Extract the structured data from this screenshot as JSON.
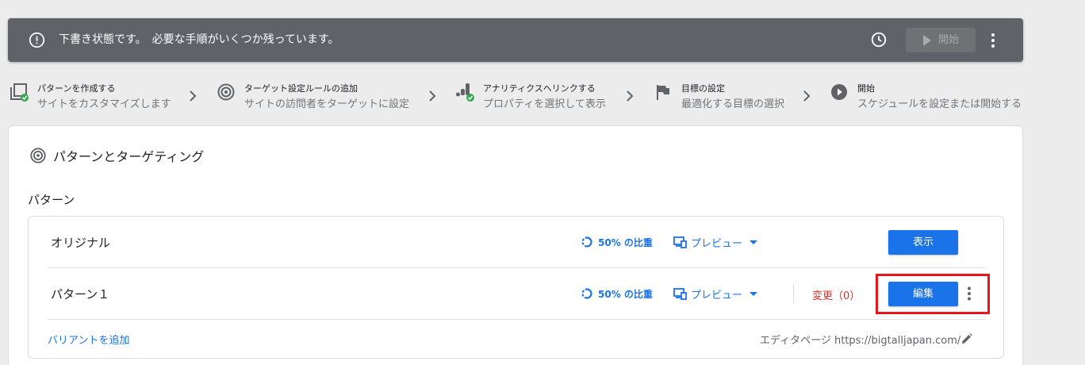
{
  "status_bar": {
    "message": "下書き状態です。　必要な手順がいくつか残っています。",
    "start_label": "開始",
    "icons": [
      "alert-circle-icon",
      "clock-icon",
      "play-icon",
      "more-vert-icon"
    ]
  },
  "steps": [
    {
      "title": "パターンを作成する",
      "subtitle": "サイトをカスタマイズします",
      "icon": "variants-check-icon"
    },
    {
      "title": "ターゲット設定ルールの追加",
      "subtitle": "サイトの訪問者をターゲットに設定",
      "icon": "target-icon"
    },
    {
      "title": "アナリティクスへリンクする",
      "subtitle": "プロパティを選択して表示",
      "icon": "analytics-check-icon"
    },
    {
      "title": "目標の設定",
      "subtitle": "最適化する目標の選択",
      "icon": "flag-icon"
    },
    {
      "title": "開始",
      "subtitle": "スケジュールを設定または開始する",
      "icon": "play-circle-icon"
    }
  ],
  "card": {
    "title": "パターンとターゲティング",
    "section_label": "パターン",
    "variants": [
      {
        "name": "オリジナル",
        "weight": "50% の比重",
        "preview": "プレビュー",
        "action": "表示"
      },
      {
        "name": "パターン１",
        "weight": "50% の比重",
        "preview": "プレビュー",
        "changes": "変更（0）",
        "action": "編集"
      }
    ],
    "add_variant": "バリアントを追加",
    "editor_page": "エディタページ https://bigtalljapan.com/"
  },
  "colors": {
    "accent": "#1a73e8",
    "status_bar_bg": "#5f6368",
    "changes_text": "#d93025",
    "highlight_box": "#e8151b",
    "check_badge": "#34a853"
  }
}
